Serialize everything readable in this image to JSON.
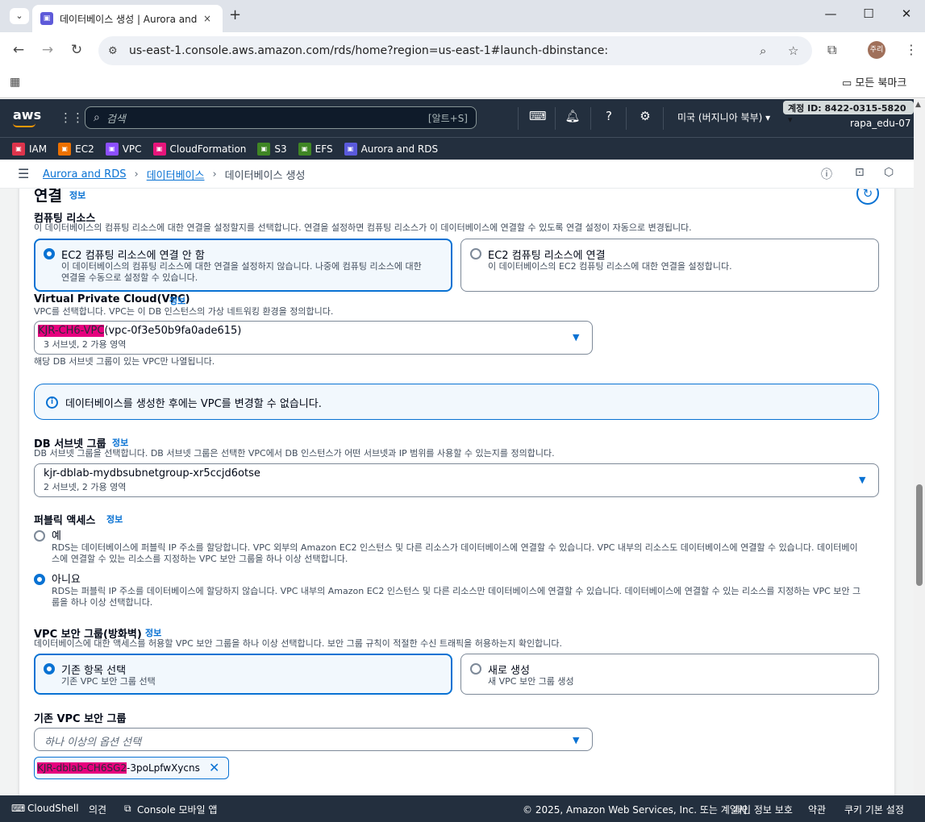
{
  "browser": {
    "tab_title": "데이터베이스 생성 | Aurora and RDS",
    "tab_close": "×",
    "new_tab": "+",
    "url": "us-east-1.console.aws.amazon.com/rds/home?region=us-east-1#launch-dbinstance:",
    "profile_initials": "주리",
    "bookmarks_all": "모든 북마크"
  },
  "aws_nav": {
    "logo": "aws",
    "search_placeholder": "검색",
    "search_shortcut": "[알트+S]",
    "region": "미국 (버지니아 북부) ▾",
    "account_id": "계정 ID: 8422-0315-5820 ▾",
    "user": "rapa_edu-07"
  },
  "favorites": [
    {
      "label": "IAM",
      "color": "#dd344c",
      "icon": "iam-icon"
    },
    {
      "label": "EC2",
      "color": "#ed7100",
      "icon": "ec2-icon"
    },
    {
      "label": "VPC",
      "color": "#8c4fff",
      "icon": "vpc-icon"
    },
    {
      "label": "CloudFormation",
      "color": "#e7157b",
      "icon": "cloudformation-icon"
    },
    {
      "label": "S3",
      "color": "#3f8624",
      "icon": "s3-icon"
    },
    {
      "label": "EFS",
      "color": "#3f8624",
      "icon": "efs-icon"
    },
    {
      "label": "Aurora and RDS",
      "color": "#5a5adc",
      "icon": "rds-icon"
    }
  ],
  "breadcrumb": {
    "items": [
      "Aurora and RDS",
      "데이터베이스",
      "데이터베이스 생성"
    ]
  },
  "connectivity": {
    "title": "연결",
    "info": "정보",
    "compute": {
      "label": "컴퓨팅 리소스",
      "desc": "이 데이터베이스의 컴퓨팅 리소스에 대한 연결을 설정할지를 선택합니다. 연결을 설정하면 컴퓨팅 리소스가 이 데이터베이스에 연결할 수 있도록 연결 설정이 자동으로 변경됩니다.",
      "opt1_title": "EC2 컴퓨팅 리소스에 연결 안 함",
      "opt1_desc1": "이 데이터베이스의 컴퓨팅 리소스에 대한 연결을 설정하지 않습니다. 나중에 컴퓨팅 리소스에 대한",
      "opt1_desc2": "연결을 수동으로 설정할 수 있습니다.",
      "opt2_title": "EC2 컴퓨팅 리소스에 연결",
      "opt2_desc": "이 데이터베이스의 EC2 컴퓨팅 리소스에 대한 연결을 설정합니다."
    },
    "vpc": {
      "label": "Virtual Private Cloud(VPC)",
      "info": "정보",
      "desc": "VPC를 선택합니다. VPC는 이 DB 인스턴스의 가상 네트워킹 환경을 정의합니다.",
      "name": "KJR-CH6-VPC",
      "id": "(vpc-0f3e50b9fa0ade615)",
      "sub": "3 서브넷, 2 가용 영역",
      "hint": "해당 DB 서브넷 그룹이 있는 VPC만 나열됩니다."
    },
    "alert": "데이터베이스를 생성한 후에는 VPC를 변경할 수 없습니다.",
    "subnet": {
      "label": "DB 서브넷 그룹",
      "info": "정보",
      "desc": "DB 서브넷 그룹을 선택합니다. DB 서브넷 그룹은 선택한 VPC에서 DB 인스턴스가 어떤 서브넷과 IP 범위를 사용할 수 있는지를 정의합니다.",
      "value": "kjr-dblab-mydbsubnetgroup-xr5ccjd6otse",
      "sub": "2 서브넷, 2 가용 영역"
    },
    "public": {
      "label": "퍼블릭 액세스",
      "info": "정보",
      "yes": "예",
      "yes_desc1": "RDS는 데이터베이스에 퍼블릭 IP 주소를 할당합니다. VPC 외부의 Amazon EC2 인스턴스 및 다른 리소스가 데이터베이스에 연결할 수 있습니다. VPC 내부의 리소스도 데이터베이스에 연결할 수 있습니다. 데이터베이",
      "yes_desc2": "스에 연결할 수 있는 리소스를 지정하는 VPC 보안 그룹을 하나 이상 선택합니다.",
      "no": "아니요",
      "no_desc1": "RDS는 퍼블릭 IP 주소를 데이터베이스에 할당하지 않습니다. VPC 내부의 Amazon EC2 인스턴스 및 다른 리소스만 데이터베이스에 연결할 수 있습니다. 데이터베이스에 연결할 수 있는 리소스를 지정하는 VPC 보안 그",
      "no_desc2": "룹을 하나 이상 선택합니다."
    },
    "sg": {
      "label": "VPC 보안 그룹(방화벽)",
      "info": "정보",
      "desc": "데이터베이스에 대한 액세스를 허용할 VPC 보안 그룹을 하나 이상 선택합니다. 보안 그룹 규칙이 적절한 수신 트래픽을 허용하는지 확인합니다.",
      "opt1_title": "기존 항목 선택",
      "opt1_desc": "기존 VPC 보안 그룹 선택",
      "opt2_title": "새로 생성",
      "opt2_desc": "새 VPC 보안 그룹 생성"
    },
    "existing_sg": {
      "label": "기존 VPC 보안 그룹",
      "placeholder": "하나 이상의 옵션 선택",
      "token_redacted": "KJR-dblab-CH6SG2",
      "token_rest": "-3poLpfwXycns"
    }
  },
  "footer": {
    "cloudshell": "CloudShell",
    "feedback": "의견",
    "mobile": "Console 모바일 앱",
    "copyright": "© 2025, Amazon Web Services, Inc. 또는 계열사.",
    "privacy": "개인 정보 보호",
    "terms": "약관",
    "cookies": "쿠키 기본 설정"
  }
}
